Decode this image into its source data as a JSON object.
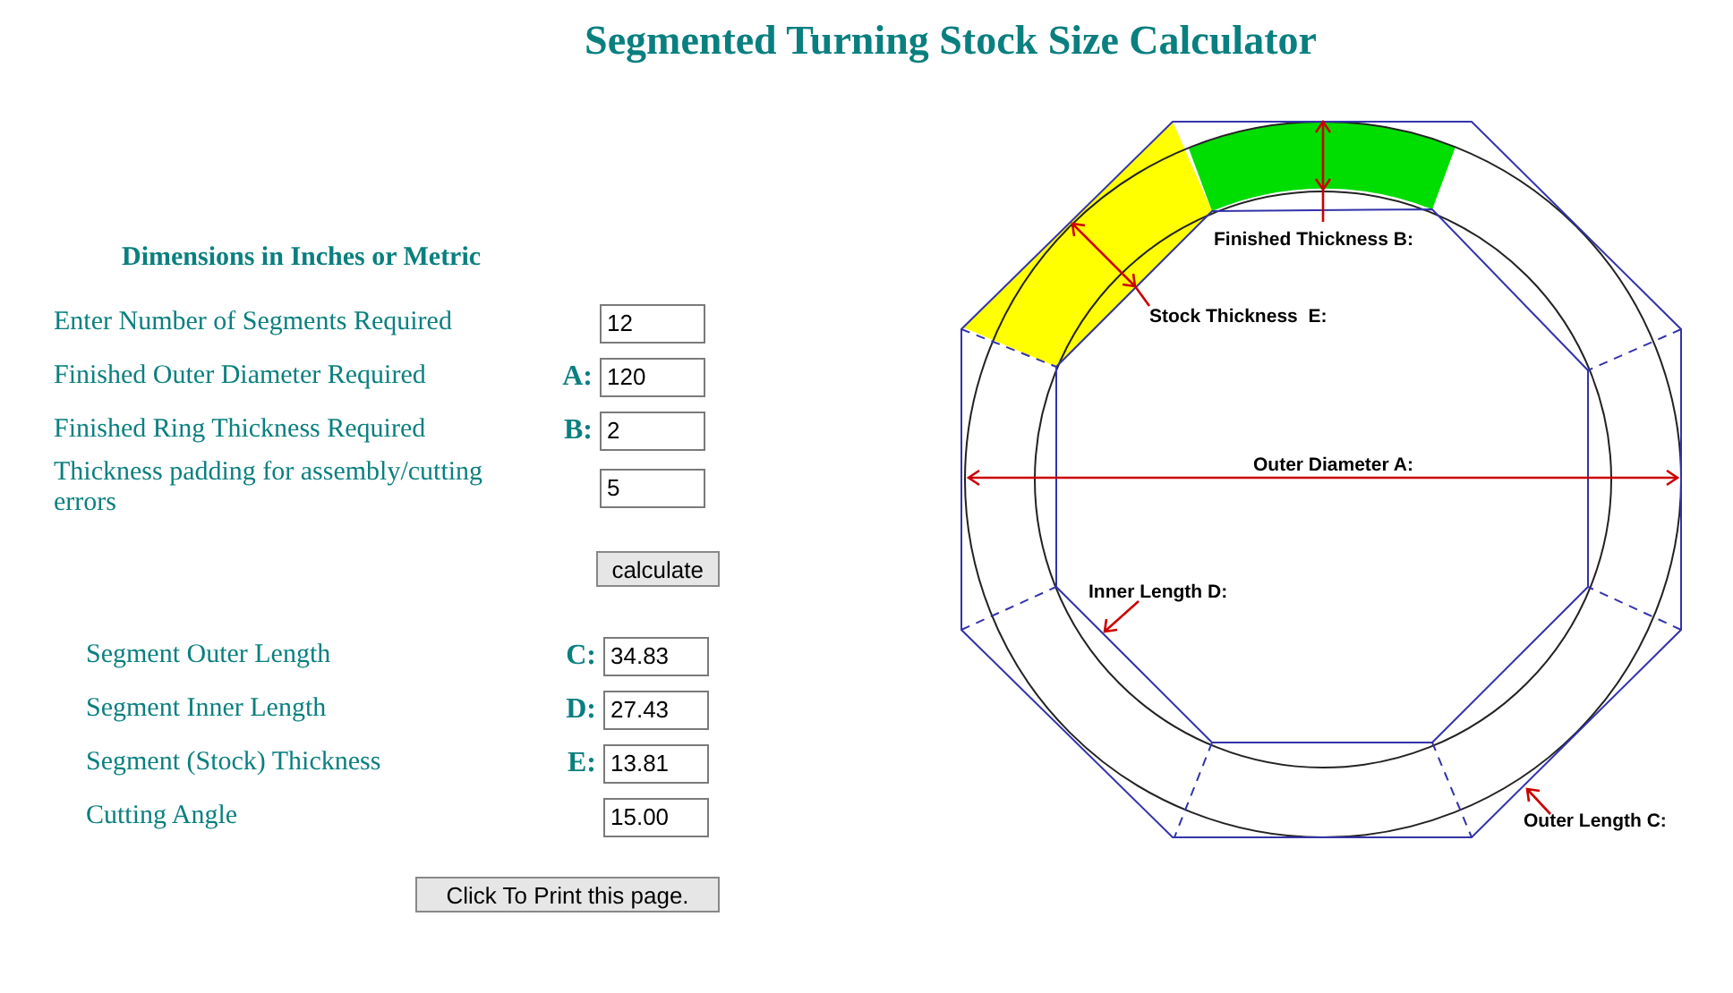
{
  "title": "Segmented Turning Stock Size Calculator",
  "inputs": {
    "heading": "Dimensions in Inches or Metric",
    "rows": [
      {
        "label": "Enter Number of Segments Required",
        "value": "12"
      },
      {
        "label": "Finished Outer Diameter Required",
        "letter": "A:",
        "value": "120"
      },
      {
        "label": "Finished Ring Thickness Required",
        "letter": "B:",
        "value": "2"
      },
      {
        "label": "Thickness padding for assembly/cutting errors",
        "value": "5"
      }
    ]
  },
  "calculate_button": "calculate",
  "results": [
    {
      "label": "Segment Outer Length",
      "letter": "C:",
      "value": "34.83"
    },
    {
      "label": "Segment Inner Length",
      "letter": "D:",
      "value": "27.43"
    },
    {
      "label": "Segment (Stock) Thickness",
      "letter": "E:",
      "value": "13.81"
    },
    {
      "label": "Cutting Angle",
      "value": "15.00"
    }
  ],
  "print_button": "Click To Print this page.",
  "diagram": {
    "labels": [
      {
        "text": "Finished Thickness B:"
      },
      {
        "text": "Stock Thickness  E:"
      },
      {
        "text": "Outer Diameter A:"
      },
      {
        "text": "Inner Length D:"
      },
      {
        "text": "Outer Length C:"
      }
    ]
  }
}
